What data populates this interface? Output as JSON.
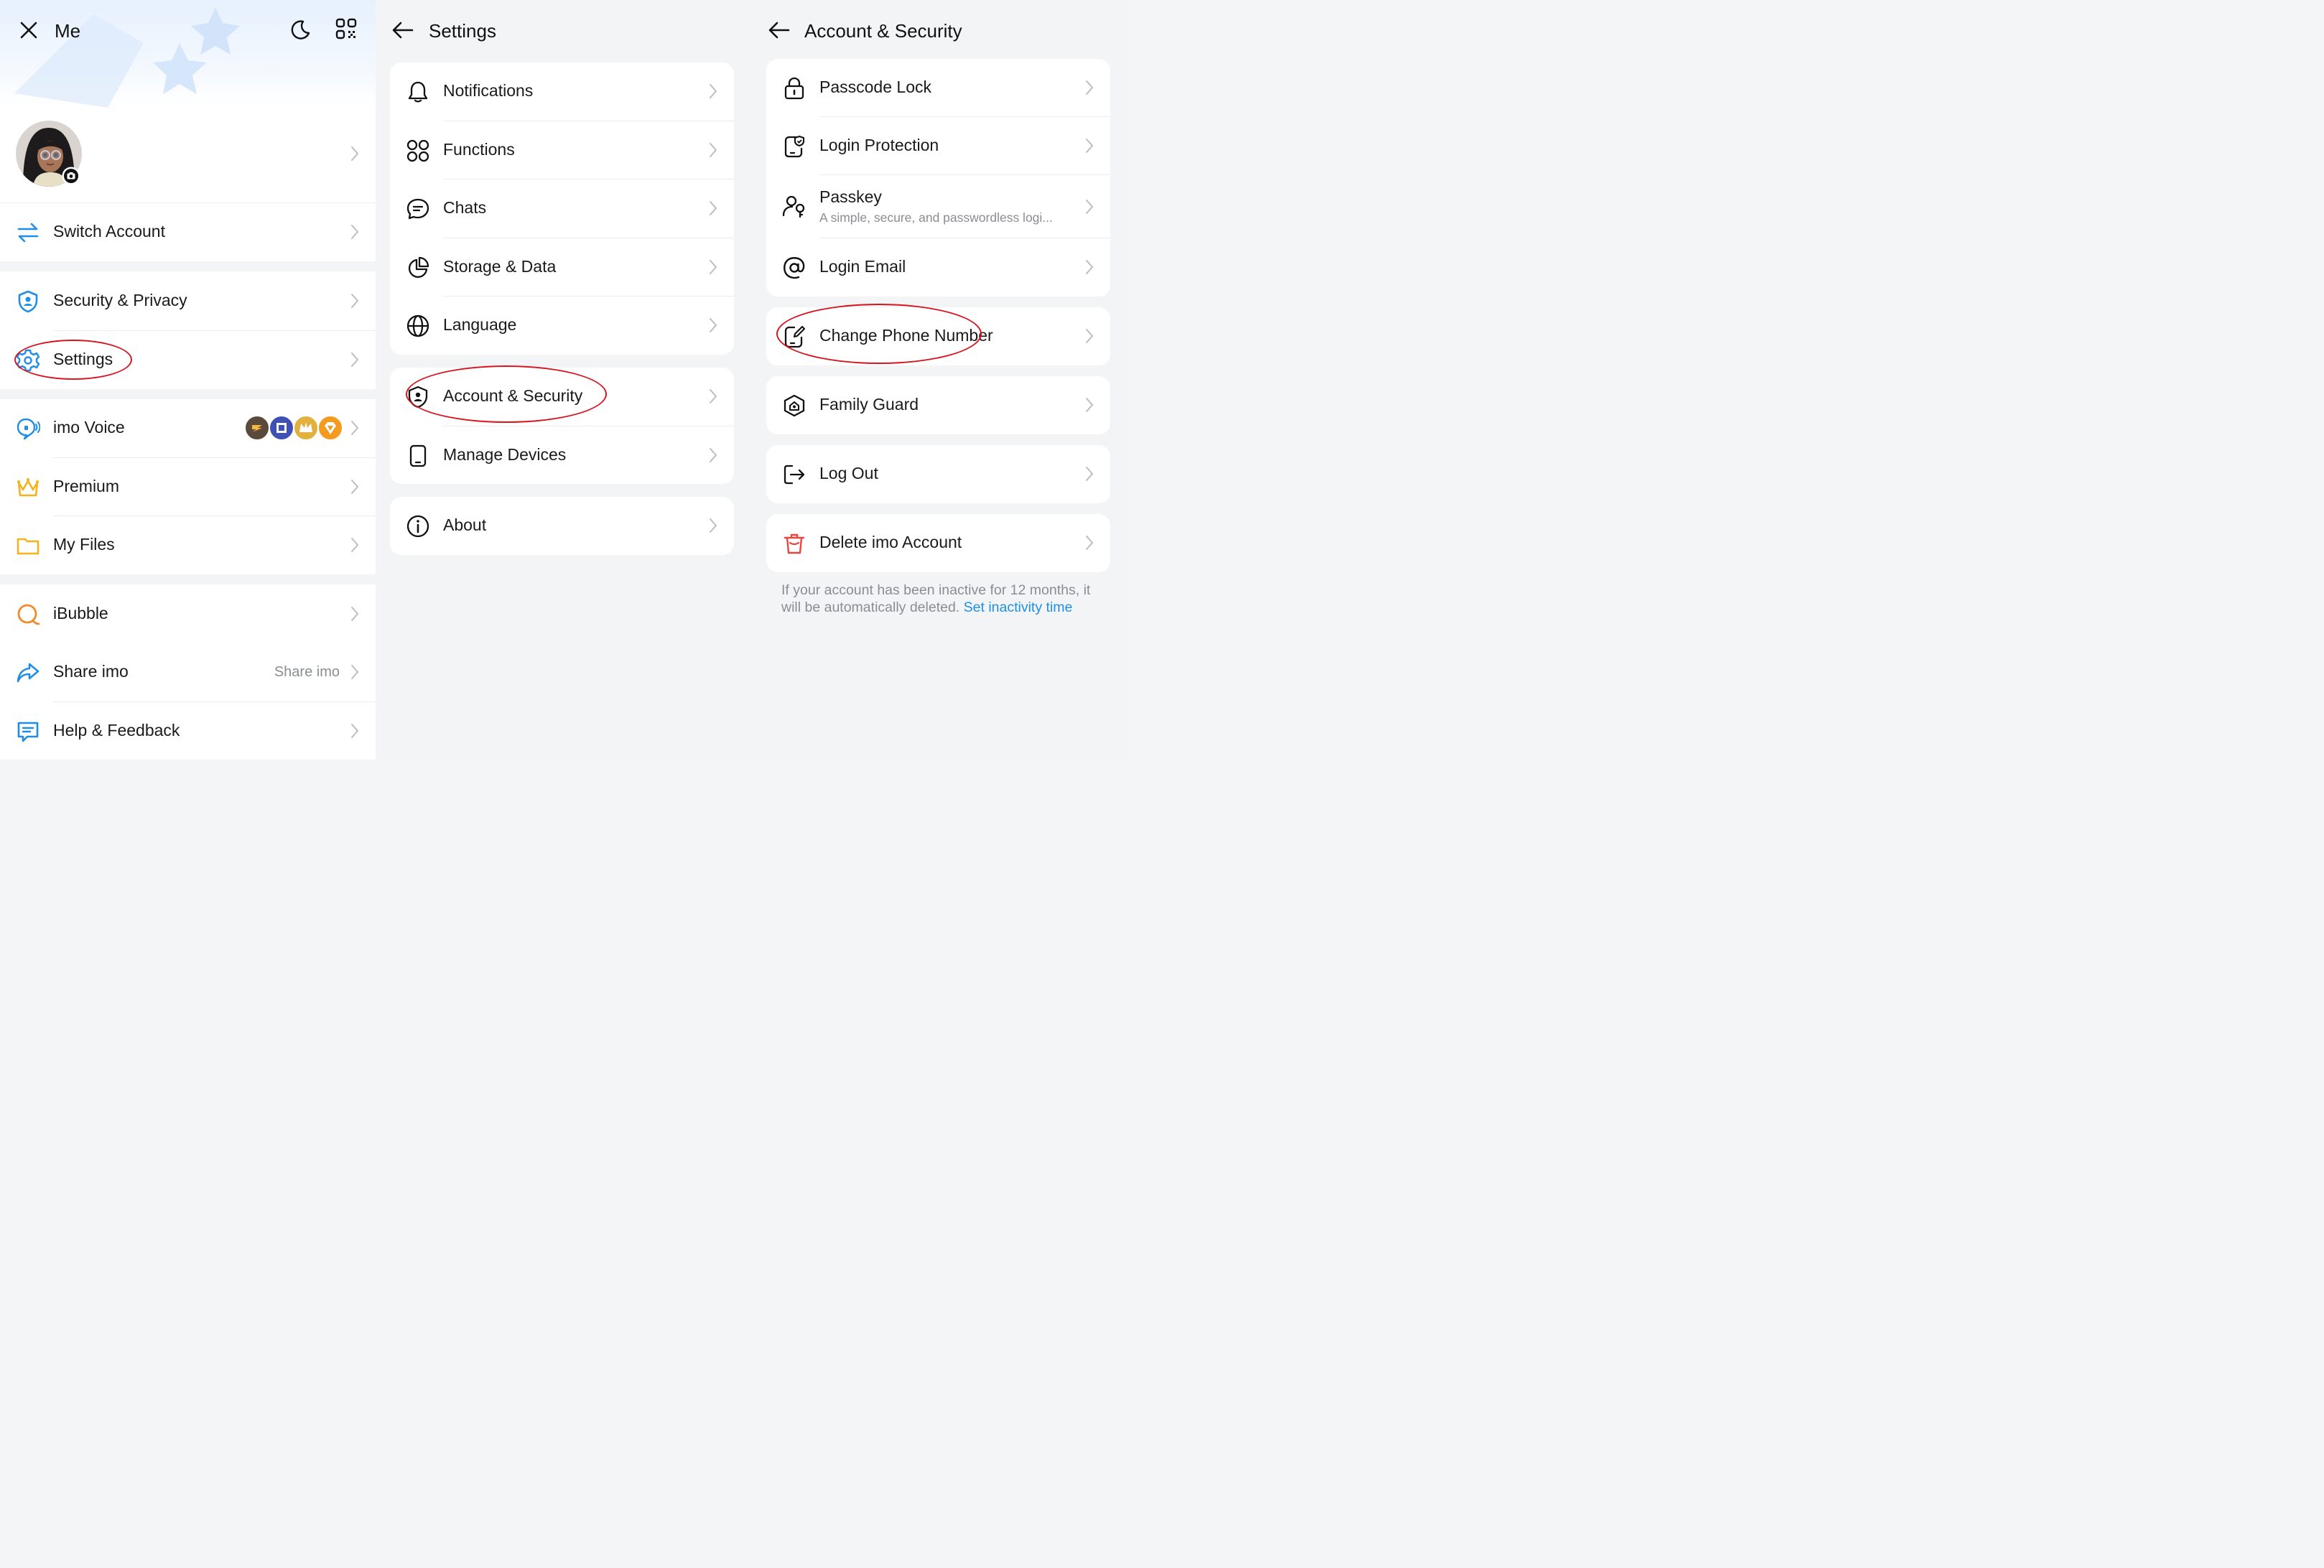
{
  "me_panel": {
    "title": "Me",
    "icons": {
      "close": "close-icon",
      "dark_mode": "moon-icon",
      "qr": "qr-code-icon",
      "camera": "camera-icon"
    },
    "switch_account": "Switch Account",
    "security_privacy": "Security & Privacy",
    "settings": "Settings",
    "imo_voice": "imo Voice",
    "premium": "Premium",
    "my_files": "My Files",
    "ibubble": "iBubble",
    "share_imo": "Share imo",
    "share_imo_value": "Share imo",
    "help_feedback": "Help & Feedback"
  },
  "settings_panel": {
    "title": "Settings",
    "items": {
      "notifications": "Notifications",
      "functions": "Functions",
      "chats": "Chats",
      "storage": "Storage & Data",
      "language": "Language",
      "account_security": "Account & Security",
      "manage_devices": "Manage Devices",
      "about": "About"
    }
  },
  "account_panel": {
    "title": "Account & Security",
    "items": {
      "passcode": "Passcode Lock",
      "login_protection": "Login Protection",
      "passkey": "Passkey",
      "passkey_sub": "A simple, secure, and passwordless logi...",
      "login_email": "Login Email",
      "change_phone": "Change Phone Number",
      "family_guard": "Family Guard",
      "log_out": "Log Out",
      "delete_account": "Delete imo Account"
    },
    "footnote": "If your account has been inactive for 12 months, it will be automatically deleted.",
    "footnote_link": "Set inactivity time"
  },
  "colors": {
    "accent_blue": "#1f8ee8",
    "annotation_red": "#d8151f",
    "delete_red": "#e8453c",
    "crown_gold": "#f5b21b",
    "folder_yellow": "#f5b21b",
    "bubble_orange": "#f08a2a"
  }
}
